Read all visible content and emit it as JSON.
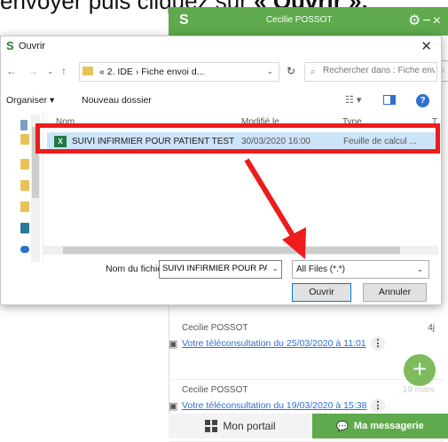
{
  "instruction": {
    "text_before": "envoyer puis cliquez sur ",
    "text_bold": "« Ouvrir »."
  },
  "app": {
    "logo": "S",
    "user": "Cecilie POSSOT",
    "icons": [
      "gear-icon",
      "minimize-icon",
      "close-icon"
    ],
    "messages": [
      {
        "sender": "Cecilie POSSOT",
        "when": "4j",
        "link": "Votre téléconsultation du 25/03/2020 à 11:01"
      },
      {
        "sender": "Cecilie POSSOT",
        "when": "19 mars",
        "link": "Votre téléconsultation du 19/03/2020 à 15:38"
      }
    ],
    "nav": {
      "portal": "Mon portail",
      "messaging": "Ma messagerie"
    },
    "colors": {
      "accent": "#5eaa4d",
      "fab": "#7dbb5c",
      "link": "#2f6fd0"
    }
  },
  "dialog": {
    "title": "Ouvrir",
    "path": "« 2. IDE › Fiche envoi d...",
    "search_placeholder": "Rechercher dans : Fiche env...",
    "toolbar": {
      "organize": "Organiser ▾",
      "new_folder": "Nouveau dossier"
    },
    "columns": {
      "name": "Nom",
      "modified": "Modifié le",
      "type": "Type",
      "size": "T"
    },
    "file": {
      "name": "SUIVI INFIRMIER POUR PATIENT TEST",
      "modified": "30/03/2020 16:00",
      "type": "Feuille de calcul ..."
    },
    "filename_label": "Nom du fichier :",
    "filename_value": "SUIVI INFIRMIER POUR PATIE",
    "filter": "All Files (*.*)",
    "open_label": "Ouvrir",
    "cancel_label": "Annuler"
  },
  "annotation_color": "#ee1c1c"
}
